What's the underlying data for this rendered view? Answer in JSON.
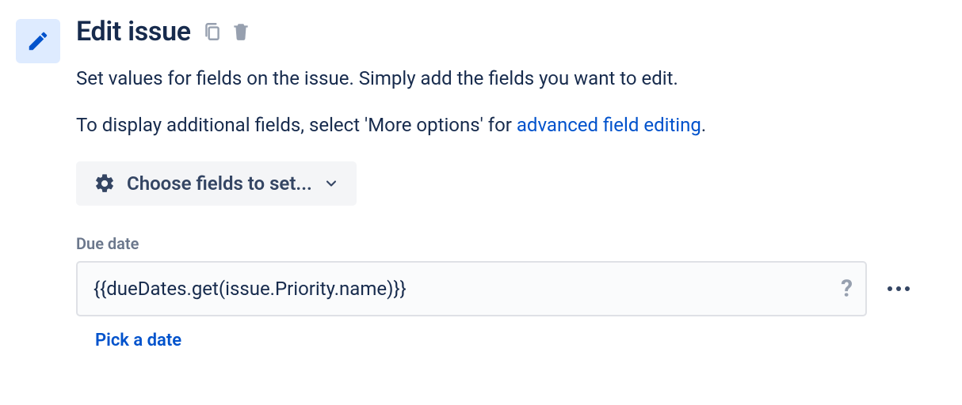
{
  "header": {
    "title": "Edit issue"
  },
  "description": {
    "line1": "Set values for fields on the issue. Simply add the fields you want to edit.",
    "line2_prefix": "To display additional fields, select 'More options' for ",
    "line2_link": "advanced field editing",
    "line2_suffix": "."
  },
  "selector": {
    "label": "Choose fields to set..."
  },
  "field": {
    "label": "Due date",
    "value": "{{dueDates.get(issue.Priority.name)}}",
    "pick_link": "Pick a date"
  }
}
